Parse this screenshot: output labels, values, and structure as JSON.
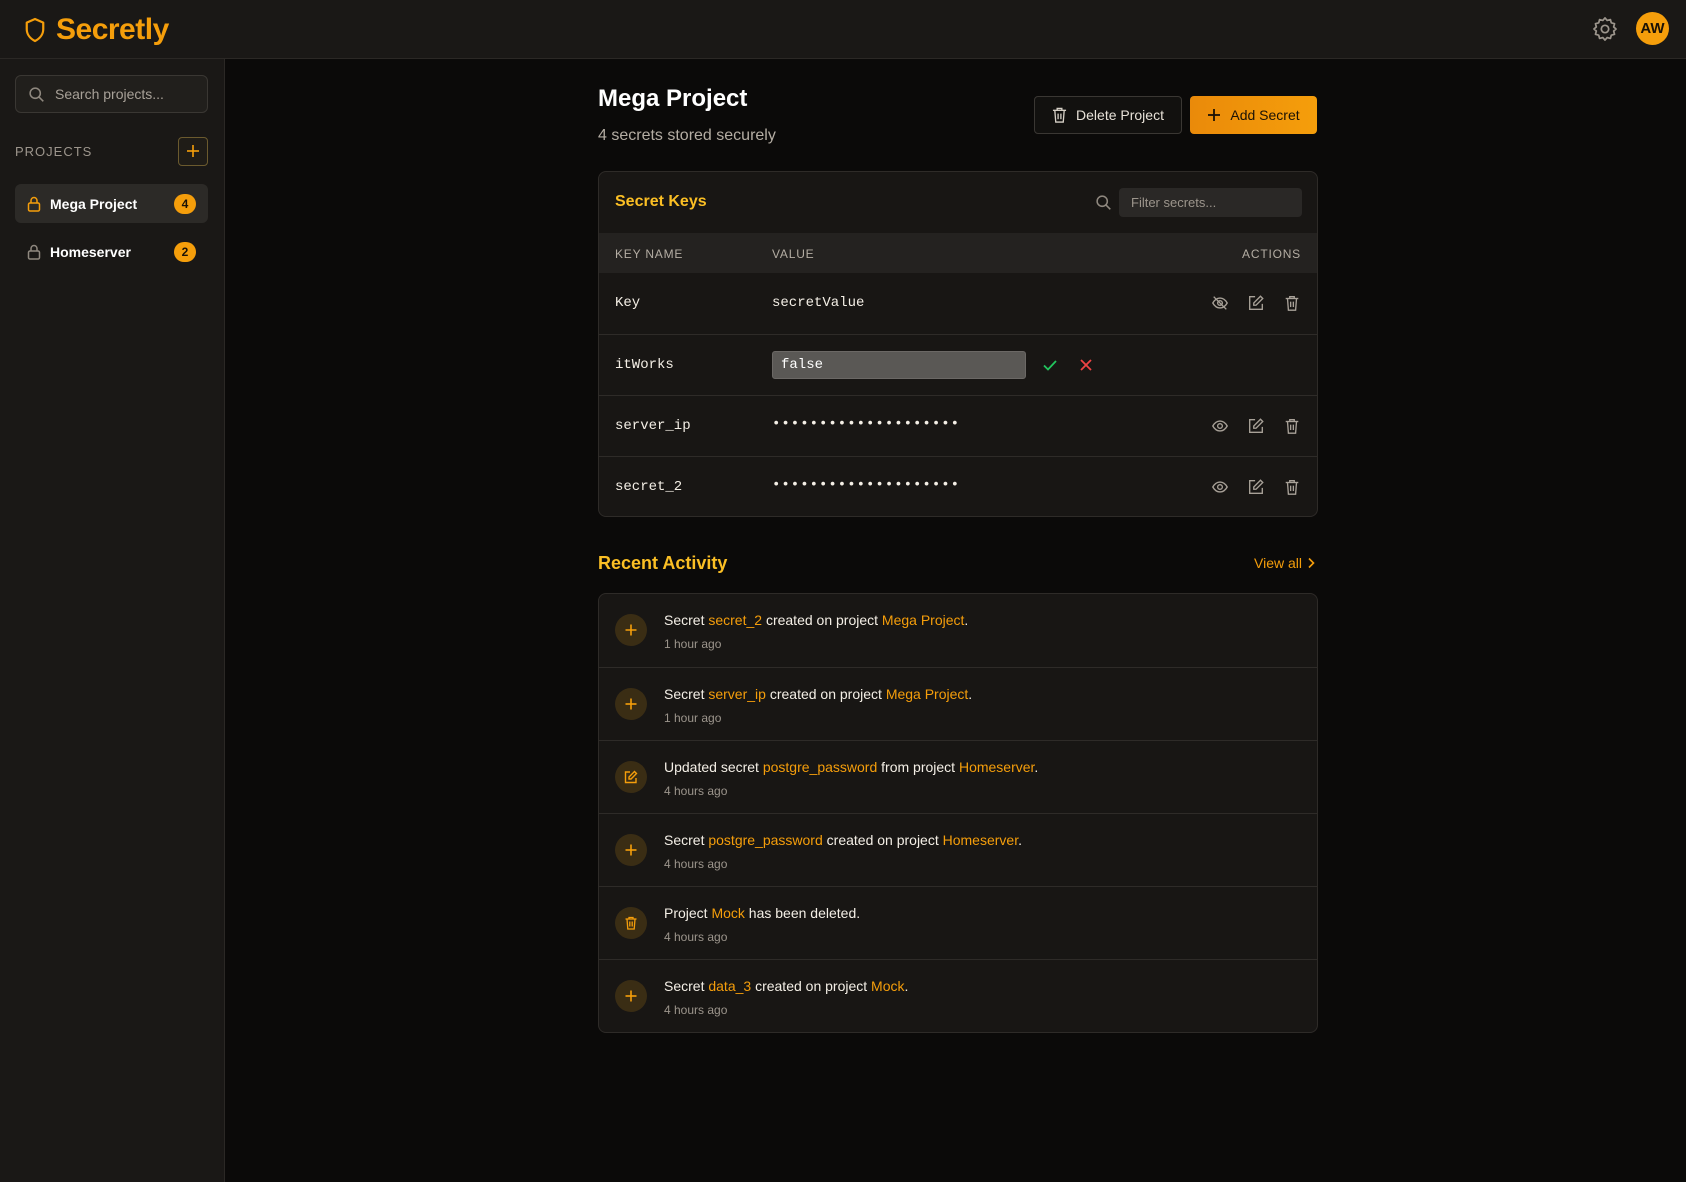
{
  "app": {
    "name": "Secretly",
    "avatar_initials": "AW",
    "accent_color": "#f59e0b"
  },
  "sidebar": {
    "search_placeholder": "Search projects...",
    "projects_label": "PROJECTS",
    "projects": [
      {
        "name": "Mega Project",
        "count": "4",
        "active": true
      },
      {
        "name": "Homeserver",
        "count": "2",
        "active": false
      }
    ]
  },
  "project": {
    "title": "Mega Project",
    "subtitle": "4 secrets stored securely",
    "delete_label": "Delete Project",
    "add_label": "Add Secret"
  },
  "secrets": {
    "title": "Secret Keys",
    "filter_placeholder": "Filter secrets...",
    "columns": [
      "KEY NAME",
      "VALUE",
      "ACTIONS"
    ],
    "rows": [
      {
        "key": "Key",
        "value": "secretValue",
        "state": "revealed"
      },
      {
        "key": "itWorks",
        "value": "false",
        "state": "editing"
      },
      {
        "key": "server_ip",
        "value": "••••••••••••••••••••",
        "state": "hidden"
      },
      {
        "key": "secret_2",
        "value": "••••••••••••••••••••",
        "state": "hidden"
      }
    ]
  },
  "activity": {
    "title": "Recent Activity",
    "view_all": "View all",
    "items": [
      {
        "icon": "plus-icon",
        "parts": [
          "Secret ",
          "secret_2",
          " created on project ",
          "Mega Project",
          "."
        ],
        "time": "1 hour ago"
      },
      {
        "icon": "plus-icon",
        "parts": [
          "Secret ",
          "server_ip",
          " created on project ",
          "Mega Project",
          "."
        ],
        "time": "1 hour ago"
      },
      {
        "icon": "edit-icon",
        "parts": [
          "Updated secret ",
          "postgre_password",
          " from project ",
          "Homeserver",
          "."
        ],
        "time": "4 hours ago"
      },
      {
        "icon": "plus-icon",
        "parts": [
          "Secret ",
          "postgre_password",
          " created on project ",
          "Homeserver",
          "."
        ],
        "time": "4 hours ago"
      },
      {
        "icon": "trash-icon",
        "parts": [
          "Project ",
          "Mock",
          " has been deleted.",
          "",
          ""
        ],
        "time": "4 hours ago"
      },
      {
        "icon": "plus-icon",
        "parts": [
          "Secret ",
          "data_3",
          " created on project ",
          "Mock",
          "."
        ],
        "time": "4 hours ago"
      }
    ]
  }
}
